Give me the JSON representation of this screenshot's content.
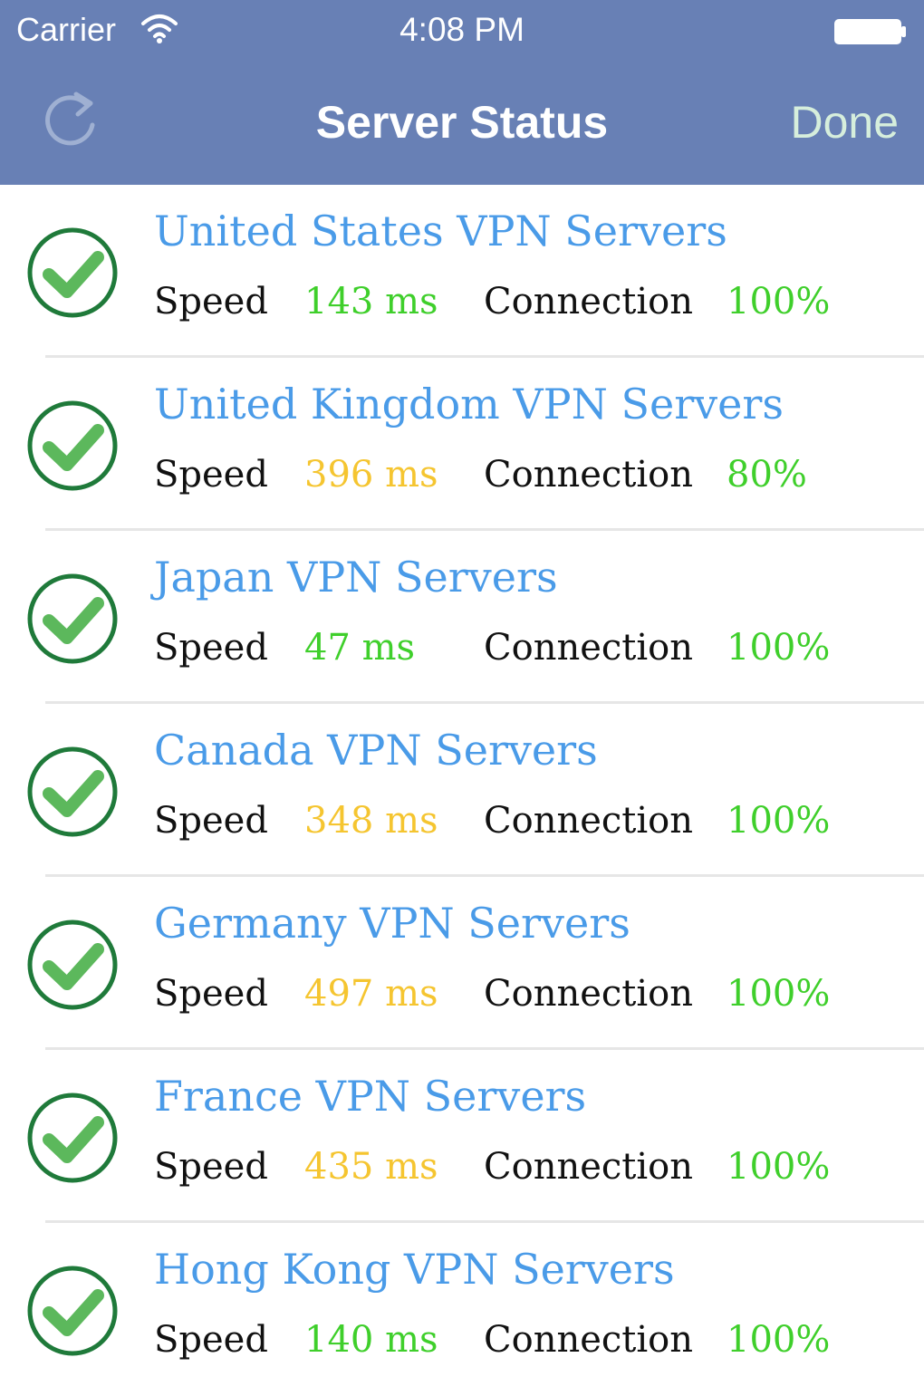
{
  "status_bar": {
    "carrier": "Carrier",
    "time": "4:08 PM"
  },
  "nav": {
    "title": "Server Status",
    "done_label": "Done",
    "refresh_icon": "refresh-icon"
  },
  "labels": {
    "speed": "Speed",
    "connection": "Connection"
  },
  "colors": {
    "bar": "#6880b5",
    "link": "#4a9be8",
    "good": "#3fcf2b",
    "warn": "#f5c530",
    "check_ring": "#1f7a3a",
    "check_mark": "#5cb85c"
  },
  "servers": [
    {
      "name": "United States VPN Servers",
      "speed": "143 ms",
      "speed_status": "good",
      "connection": "100%",
      "connection_status": "good"
    },
    {
      "name": "United Kingdom VPN Servers",
      "speed": "396 ms",
      "speed_status": "warn",
      "connection": "80%",
      "connection_status": "good"
    },
    {
      "name": "Japan VPN Servers",
      "speed": "47 ms",
      "speed_status": "good",
      "connection": "100%",
      "connection_status": "good"
    },
    {
      "name": "Canada VPN Servers",
      "speed": "348 ms",
      "speed_status": "warn",
      "connection": "100%",
      "connection_status": "good"
    },
    {
      "name": "Germany VPN Servers",
      "speed": "497 ms",
      "speed_status": "warn",
      "connection": "100%",
      "connection_status": "good"
    },
    {
      "name": "France VPN Servers",
      "speed": "435 ms",
      "speed_status": "warn",
      "connection": "100%",
      "connection_status": "good"
    },
    {
      "name": "Hong Kong VPN Servers",
      "speed": "140 ms",
      "speed_status": "good",
      "connection": "100%",
      "connection_status": "good"
    }
  ]
}
